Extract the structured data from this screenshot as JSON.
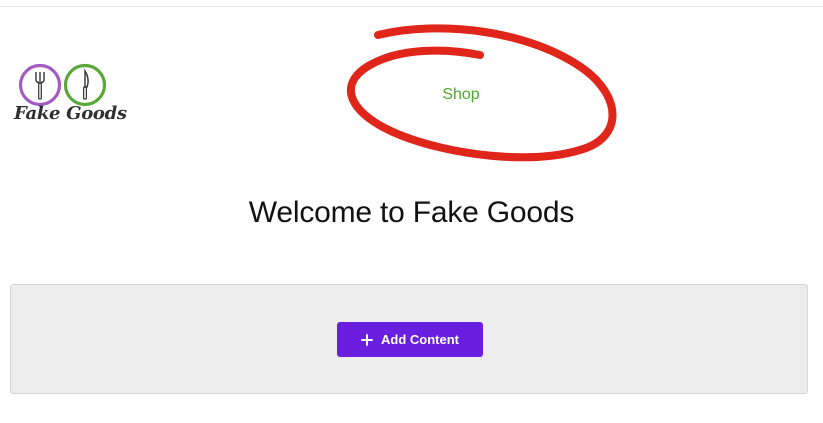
{
  "header": {
    "logo": {
      "text": "Fake Goods",
      "fork_circle_color": "#a45bc3",
      "knife_circle_color": "#5aa83a"
    },
    "nav": {
      "shop_label": "Shop",
      "shop_color": "#4fa832"
    }
  },
  "annotation": {
    "shape": "hand-drawn circle",
    "color": "#e0251b"
  },
  "main": {
    "title": "Welcome to Fake Goods",
    "add_content": {
      "label": "Add Content",
      "icon": "plus-icon",
      "color": "#6a1fe0"
    }
  }
}
